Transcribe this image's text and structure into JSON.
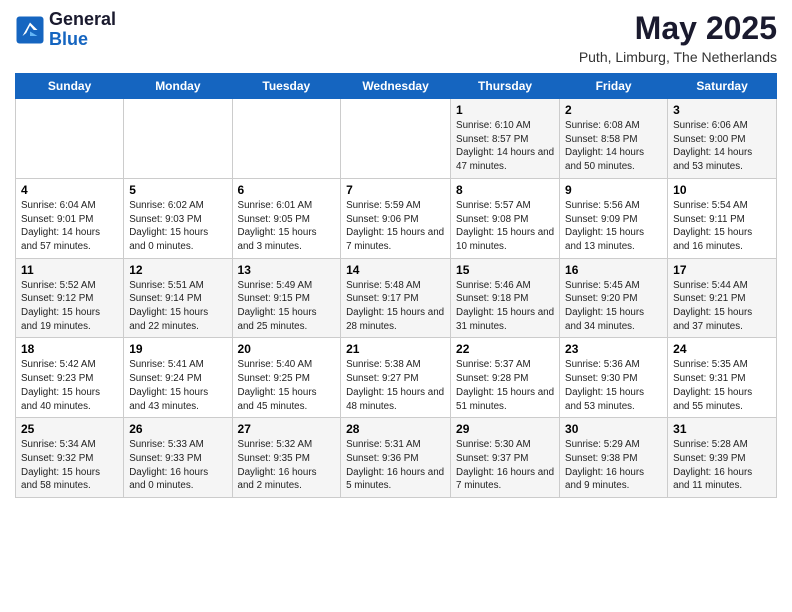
{
  "header": {
    "logo": {
      "general": "General",
      "blue": "Blue"
    },
    "title": "May 2025",
    "subtitle": "Puth, Limburg, The Netherlands"
  },
  "days_of_week": [
    "Sunday",
    "Monday",
    "Tuesday",
    "Wednesday",
    "Thursday",
    "Friday",
    "Saturday"
  ],
  "weeks": [
    [
      {
        "day": null
      },
      {
        "day": null
      },
      {
        "day": null
      },
      {
        "day": null
      },
      {
        "day": 1,
        "sunrise": "6:10 AM",
        "sunset": "8:57 PM",
        "daylight": "14 hours and 47 minutes."
      },
      {
        "day": 2,
        "sunrise": "6:08 AM",
        "sunset": "8:58 PM",
        "daylight": "14 hours and 50 minutes."
      },
      {
        "day": 3,
        "sunrise": "6:06 AM",
        "sunset": "9:00 PM",
        "daylight": "14 hours and 53 minutes."
      }
    ],
    [
      {
        "day": 4,
        "sunrise": "6:04 AM",
        "sunset": "9:01 PM",
        "daylight": "14 hours and 57 minutes."
      },
      {
        "day": 5,
        "sunrise": "6:02 AM",
        "sunset": "9:03 PM",
        "daylight": "15 hours and 0 minutes."
      },
      {
        "day": 6,
        "sunrise": "6:01 AM",
        "sunset": "9:05 PM",
        "daylight": "15 hours and 3 minutes."
      },
      {
        "day": 7,
        "sunrise": "5:59 AM",
        "sunset": "9:06 PM",
        "daylight": "15 hours and 7 minutes."
      },
      {
        "day": 8,
        "sunrise": "5:57 AM",
        "sunset": "9:08 PM",
        "daylight": "15 hours and 10 minutes."
      },
      {
        "day": 9,
        "sunrise": "5:56 AM",
        "sunset": "9:09 PM",
        "daylight": "15 hours and 13 minutes."
      },
      {
        "day": 10,
        "sunrise": "5:54 AM",
        "sunset": "9:11 PM",
        "daylight": "15 hours and 16 minutes."
      }
    ],
    [
      {
        "day": 11,
        "sunrise": "5:52 AM",
        "sunset": "9:12 PM",
        "daylight": "15 hours and 19 minutes."
      },
      {
        "day": 12,
        "sunrise": "5:51 AM",
        "sunset": "9:14 PM",
        "daylight": "15 hours and 22 minutes."
      },
      {
        "day": 13,
        "sunrise": "5:49 AM",
        "sunset": "9:15 PM",
        "daylight": "15 hours and 25 minutes."
      },
      {
        "day": 14,
        "sunrise": "5:48 AM",
        "sunset": "9:17 PM",
        "daylight": "15 hours and 28 minutes."
      },
      {
        "day": 15,
        "sunrise": "5:46 AM",
        "sunset": "9:18 PM",
        "daylight": "15 hours and 31 minutes."
      },
      {
        "day": 16,
        "sunrise": "5:45 AM",
        "sunset": "9:20 PM",
        "daylight": "15 hours and 34 minutes."
      },
      {
        "day": 17,
        "sunrise": "5:44 AM",
        "sunset": "9:21 PM",
        "daylight": "15 hours and 37 minutes."
      }
    ],
    [
      {
        "day": 18,
        "sunrise": "5:42 AM",
        "sunset": "9:23 PM",
        "daylight": "15 hours and 40 minutes."
      },
      {
        "day": 19,
        "sunrise": "5:41 AM",
        "sunset": "9:24 PM",
        "daylight": "15 hours and 43 minutes."
      },
      {
        "day": 20,
        "sunrise": "5:40 AM",
        "sunset": "9:25 PM",
        "daylight": "15 hours and 45 minutes."
      },
      {
        "day": 21,
        "sunrise": "5:38 AM",
        "sunset": "9:27 PM",
        "daylight": "15 hours and 48 minutes."
      },
      {
        "day": 22,
        "sunrise": "5:37 AM",
        "sunset": "9:28 PM",
        "daylight": "15 hours and 51 minutes."
      },
      {
        "day": 23,
        "sunrise": "5:36 AM",
        "sunset": "9:30 PM",
        "daylight": "15 hours and 53 minutes."
      },
      {
        "day": 24,
        "sunrise": "5:35 AM",
        "sunset": "9:31 PM",
        "daylight": "15 hours and 55 minutes."
      }
    ],
    [
      {
        "day": 25,
        "sunrise": "5:34 AM",
        "sunset": "9:32 PM",
        "daylight": "15 hours and 58 minutes."
      },
      {
        "day": 26,
        "sunrise": "5:33 AM",
        "sunset": "9:33 PM",
        "daylight": "16 hours and 0 minutes."
      },
      {
        "day": 27,
        "sunrise": "5:32 AM",
        "sunset": "9:35 PM",
        "daylight": "16 hours and 2 minutes."
      },
      {
        "day": 28,
        "sunrise": "5:31 AM",
        "sunset": "9:36 PM",
        "daylight": "16 hours and 5 minutes."
      },
      {
        "day": 29,
        "sunrise": "5:30 AM",
        "sunset": "9:37 PM",
        "daylight": "16 hours and 7 minutes."
      },
      {
        "day": 30,
        "sunrise": "5:29 AM",
        "sunset": "9:38 PM",
        "daylight": "16 hours and 9 minutes."
      },
      {
        "day": 31,
        "sunrise": "5:28 AM",
        "sunset": "9:39 PM",
        "daylight": "16 hours and 11 minutes."
      }
    ]
  ]
}
